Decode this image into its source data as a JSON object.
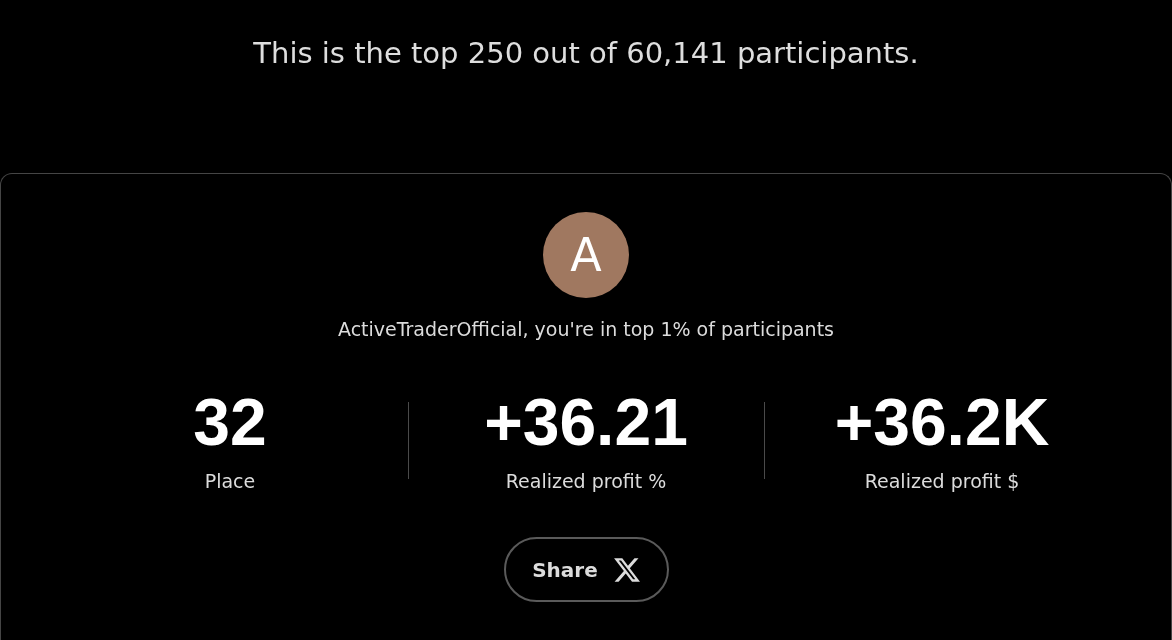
{
  "headline": "This is the top 250 out of 60,141 participants.",
  "card": {
    "avatar": {
      "initial": "A"
    },
    "message": "ActiveTraderOfficial, you're in top 1% of participants",
    "stats": [
      {
        "value": "32",
        "label": "Place"
      },
      {
        "value": "+36.21",
        "label": "Realized profit %"
      },
      {
        "value": "+36.2K",
        "label": "Realized profit $"
      }
    ],
    "share_button": {
      "label": "Share"
    }
  }
}
